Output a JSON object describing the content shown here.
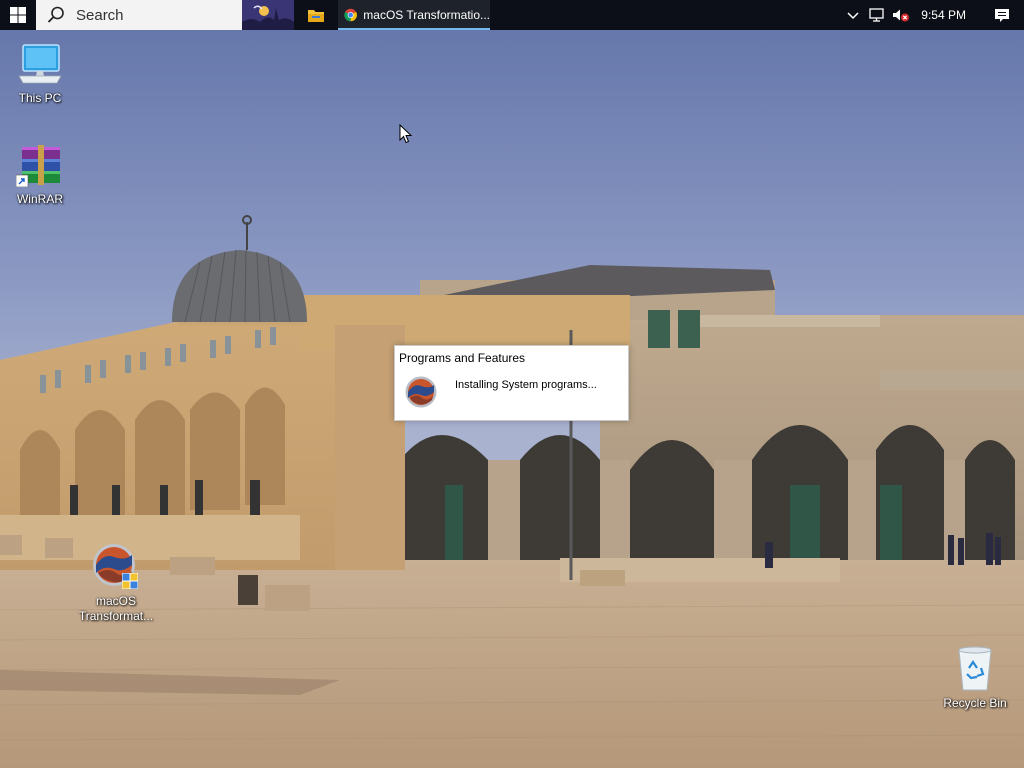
{
  "taskbar": {
    "search_placeholder": "Search",
    "chrome_window_title": "macOS Transformatio...",
    "clock": "9:54 PM",
    "start_icon": "windows-logo-icon",
    "tray_icons": [
      "chevron-up-icon",
      "network-icon",
      "volume-muted-icon",
      "action-center-icon"
    ]
  },
  "desktop": {
    "icons": [
      {
        "label": "This PC",
        "icon": "computer-icon"
      },
      {
        "label": "WinRAR",
        "icon": "winrar-icon"
      },
      {
        "label_line1": "macOS",
        "label_line2": "Transformat...",
        "icon": "macos-installer-icon"
      },
      {
        "label": "Recycle Bin",
        "icon": "recycle-bin-icon"
      }
    ]
  },
  "dialog": {
    "title": "Programs and Features",
    "message": "Installing System programs..."
  },
  "colors": {
    "taskbar": "#0c0f17",
    "active_indicator": "#76b9ed",
    "sky_top": "#6b7eb2",
    "stone": "#c8a77e"
  }
}
